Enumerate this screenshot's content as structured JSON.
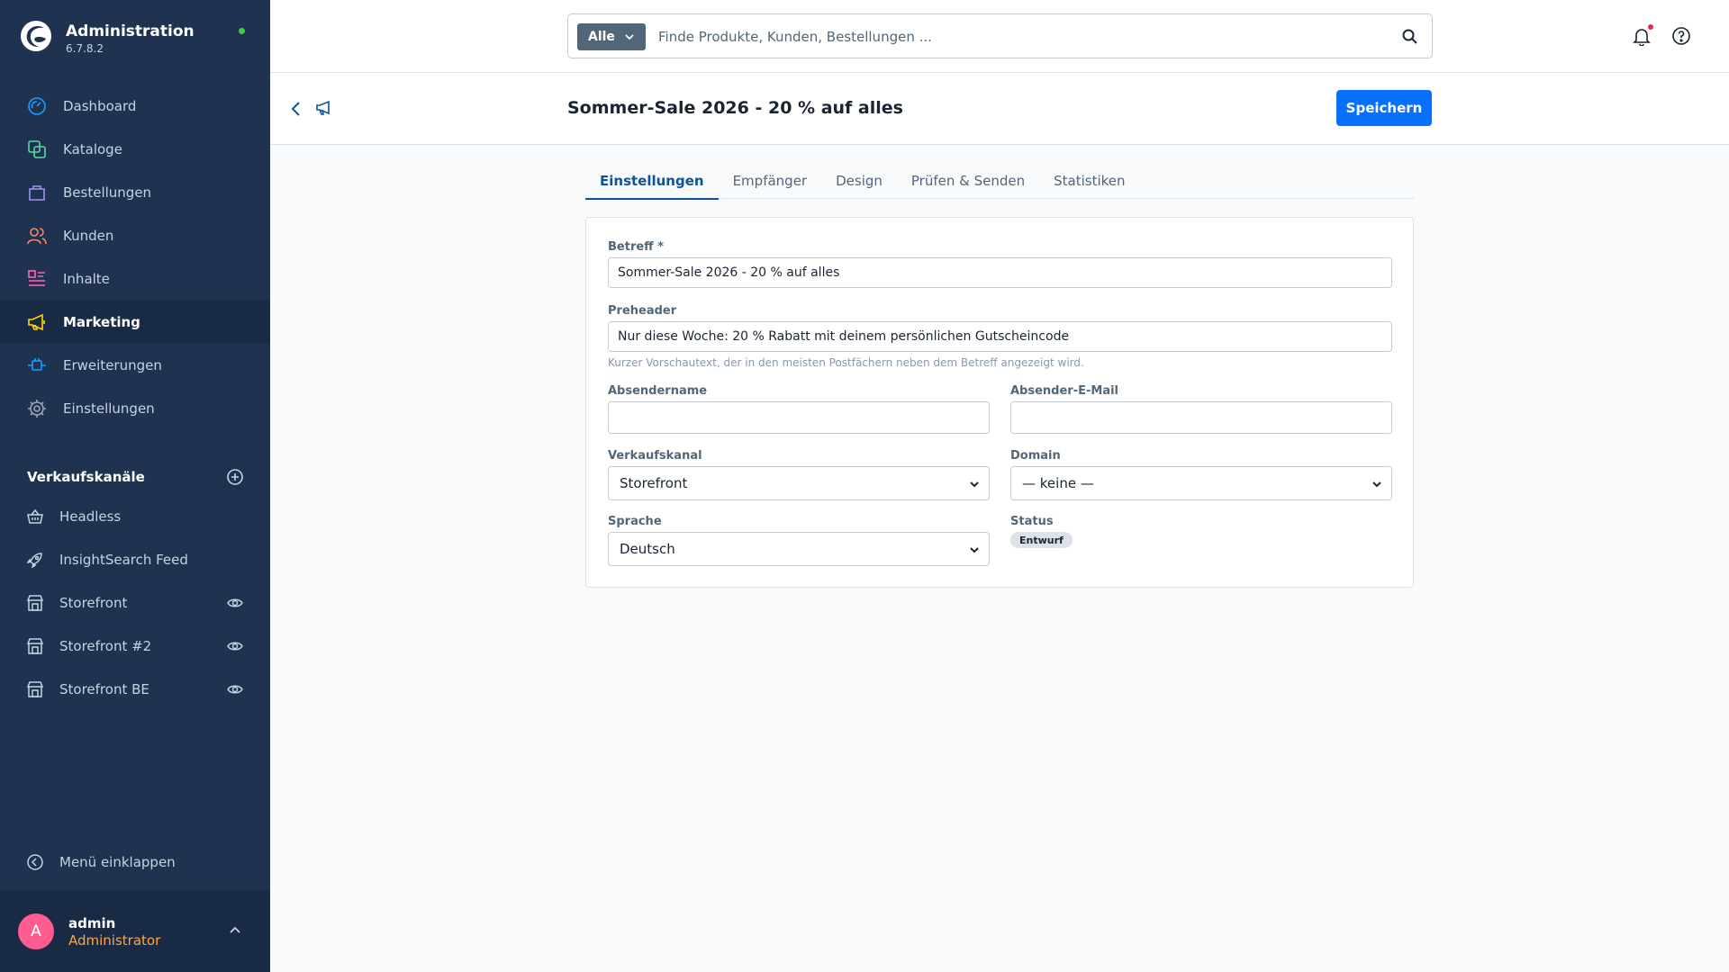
{
  "app": {
    "title": "Administration",
    "version": "6.7.8.2",
    "status_color": "#37d046"
  },
  "sidebar": {
    "items": [
      {
        "label": "Dashboard",
        "icon": "dashboard-gauge-icon",
        "color": "#189eff"
      },
      {
        "label": "Kataloge",
        "icon": "catalog-layers-icon",
        "color": "#57d9a3"
      },
      {
        "label": "Bestellungen",
        "icon": "orders-bag-icon",
        "color": "#a092f0"
      },
      {
        "label": "Kunden",
        "icon": "customers-users-icon",
        "color": "#f88962"
      },
      {
        "label": "Inhalte",
        "icon": "content-list-icon",
        "color": "#ff68b4"
      },
      {
        "label": "Marketing",
        "icon": "marketing-megaphone-icon",
        "color": "#ffd700"
      },
      {
        "label": "Erweiterungen",
        "icon": "extensions-plug-icon",
        "color": "#189eff"
      },
      {
        "label": "Einstellungen",
        "icon": "settings-gear-icon",
        "color": "#9aa8b5"
      }
    ],
    "active_item": "Marketing",
    "channels_label": "Verkaufskanäle",
    "channels": [
      {
        "label": "Headless",
        "icon": "basket-icon"
      },
      {
        "label": "InsightSearch Feed",
        "icon": "rocket-icon"
      },
      {
        "label": "Storefront",
        "icon": "storefront-icon",
        "has_eye": true
      },
      {
        "label": "Storefront #2",
        "icon": "storefront-icon",
        "has_eye": true
      },
      {
        "label": "Storefront BE",
        "icon": "storefront-icon",
        "has_eye": true
      }
    ],
    "collapse_label": "Menü einklappen"
  },
  "user": {
    "initial": "A",
    "name": "admin",
    "role": "Administrator",
    "avatar_color": "#ff5d8f"
  },
  "search": {
    "type_label": "Alle",
    "placeholder": "Finde Produkte, Kunden, Bestellungen ..."
  },
  "page": {
    "title": "Sommer-Sale 2026 - 20 % auf alles",
    "save_label": "Speichern"
  },
  "tabs": [
    {
      "label": "Einstellungen",
      "active": true
    },
    {
      "label": "Empfänger"
    },
    {
      "label": "Design"
    },
    {
      "label": "Prüfen & Senden"
    },
    {
      "label": "Statistiken"
    }
  ],
  "form": {
    "subject": {
      "label": "Betreff *",
      "value": "Sommer-Sale 2026 - 20 % auf alles"
    },
    "preheader": {
      "label": "Preheader",
      "value": "Nur diese Woche: 20 % Rabatt mit deinem persönlichen Gutscheincode",
      "hint": "Kurzer Vorschautext, der in den meisten Postfächern neben dem Betreff angezeigt wird."
    },
    "sender_name": {
      "label": "Absendername",
      "value": ""
    },
    "sender_email": {
      "label": "Absender-E-Mail",
      "value": ""
    },
    "sales_channel": {
      "label": "Verkaufskanal",
      "value": "Storefront"
    },
    "domain": {
      "label": "Domain",
      "value": "— keine —"
    },
    "language": {
      "label": "Sprache",
      "value": "Deutsch"
    },
    "status": {
      "label": "Status",
      "value": "Entwurf"
    }
  },
  "colors": {
    "sidebar_bg": "#1f3350",
    "primary": "#0870ff",
    "tab_active": "#0b539b",
    "notification_dot": "#de294c"
  }
}
